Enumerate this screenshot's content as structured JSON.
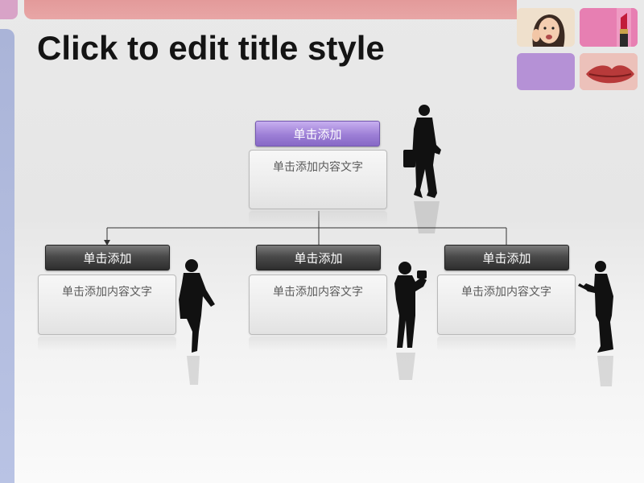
{
  "slide": {
    "title": "Click to edit title style"
  },
  "org_chart": {
    "top": {
      "header": "单击添加",
      "content": "单击添加内容文字"
    },
    "children": [
      {
        "header": "单击添加",
        "content": "单击添加内容文字"
      },
      {
        "header": "单击添加",
        "content": "单击添加内容文字"
      },
      {
        "header": "单击添加",
        "content": "单击添加内容文字"
      }
    ]
  },
  "colors": {
    "top_strip": "#e39a9a",
    "left_strip": "#aab4d8",
    "header_dark": "#3a3a3a",
    "header_purple": "#9d7fd6"
  }
}
